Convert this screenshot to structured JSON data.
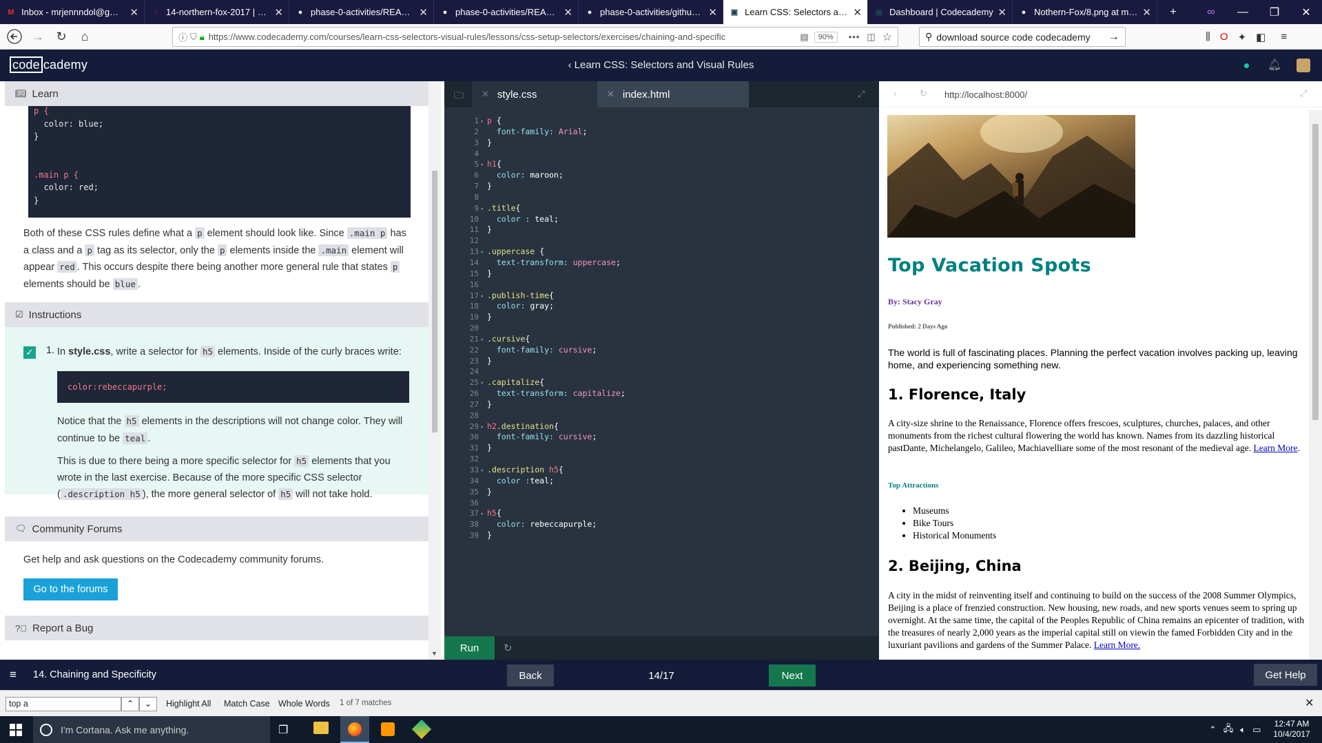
{
  "browser": {
    "tabs": [
      {
        "label": "Inbox - mrjennndol@gmail.c",
        "icon": "gmail-icon",
        "color": "#d93025",
        "glyph": "M"
      },
      {
        "label": "14-northern-fox-2017 | Hack",
        "icon": "slack-icon",
        "color": "#4a154b",
        "glyph": "#"
      },
      {
        "label": "phase-0-activities/README.",
        "icon": "github-icon",
        "color": "#ffffff",
        "glyph": "●"
      },
      {
        "label": "phase-0-activities/README.",
        "icon": "github-icon",
        "color": "#ffffff",
        "glyph": "●"
      },
      {
        "label": "phase-0-activities/github-p",
        "icon": "github-icon",
        "color": "#ffffff",
        "glyph": "●"
      },
      {
        "label": "Learn CSS: Selectors and Visu",
        "icon": "codecademy-icon",
        "color": "#1f4056",
        "glyph": "▣",
        "active": true
      },
      {
        "label": "Dashboard | Codecademy",
        "icon": "codecademy-icon",
        "color": "#1f4056",
        "glyph": "▣"
      },
      {
        "label": "Nothern-Fox/8.png at maste",
        "icon": "github-icon",
        "color": "#ffffff",
        "glyph": "●"
      }
    ],
    "url": "https://www.codecademy.com/courses/learn-css-selectors-visual-rules/lessons/css-setup-selectors/exercises/chaining-and-specific",
    "zoom": "90%",
    "search": "download source code codecademy",
    "menu_dots": "•••"
  },
  "codecademy": {
    "logo_code": "code",
    "logo_rest": "cademy",
    "course_title": "Learn CSS: Selectors and Visual Rules",
    "lesson_label": "14. Chaining and Specificity",
    "back": "Back",
    "progress": "14/17",
    "next": "Next",
    "get_help": "Get Help"
  },
  "learn": {
    "header": "Learn",
    "code_lines": [
      "p {",
      "  color: blue;",
      "}",
      "",
      "",
      ".main p {",
      "  color: red;",
      "}"
    ],
    "para": {
      "t1": "Both of these CSS rules define what a ",
      "c1": "p",
      "t2": " element should look like. Since ",
      "c2": ".main p",
      "t3": " has a class and a ",
      "c3": "p",
      "t4": " tag as its selector, only the ",
      "c4": "p",
      "t5": " elements inside the ",
      "c5": ".main",
      "t6": " element will appear ",
      "c6": "red",
      "t7": ". This occurs despite there being another more general rule that states ",
      "c7": "p",
      "t8": " elements should be ",
      "c8": "blue",
      "t9": "."
    }
  },
  "instructions": {
    "header": "Instructions",
    "step_num": "1.",
    "s1": "In ",
    "s_file": "style.css",
    "s2": ", write a selector for ",
    "s_code": "h5",
    "s3": " elements. Inside of the curly braces write:",
    "code_prop": "color:",
    "code_val": " rebeccapurple;",
    "n1": "Notice that the ",
    "n_code": "h5",
    "n2": " elements in the descriptions will not change color. They will continue to be ",
    "n_code2": "teal",
    "n3": ".",
    "m1": "This is due to there being a more specific selector for ",
    "m_code": "h5",
    "m2": " elements that you wrote in the last exercise. Because of the more specific CSS selector (",
    "m_code2": ".description h5",
    "m3": "), the more general selector of ",
    "m_code3": "h5",
    "m4": " will not take hold."
  },
  "community": {
    "header": "Community Forums",
    "text": "Get help and ask questions on the Codecademy community forums.",
    "button": "Go to the forums"
  },
  "report": {
    "header": "Report a Bug"
  },
  "editor": {
    "tab_css": "style.css",
    "tab_html": "index.html",
    "run": "Run",
    "lines": [
      {
        "n": "1",
        "f": "▾",
        "parts": [
          [
            "sel2",
            "p "
          ],
          [
            "w",
            "{"
          ]
        ]
      },
      {
        "n": "2",
        "parts": [
          [
            "pr",
            "  font-family: "
          ],
          [
            "vl",
            "Arial"
          ],
          [
            "w",
            ";"
          ]
        ]
      },
      {
        "n": "3",
        "parts": [
          [
            "w",
            "}"
          ]
        ]
      },
      {
        "n": "4",
        "parts": []
      },
      {
        "n": "5",
        "f": "▾",
        "parts": [
          [
            "sel2",
            "h1"
          ],
          [
            "w",
            "{"
          ]
        ]
      },
      {
        "n": "6",
        "parts": [
          [
            "pr",
            "  color: "
          ],
          [
            "vl2",
            "maroon"
          ],
          [
            "w",
            ";"
          ]
        ]
      },
      {
        "n": "7",
        "parts": [
          [
            "w",
            "}"
          ]
        ]
      },
      {
        "n": "8",
        "parts": []
      },
      {
        "n": "9",
        "f": "▾",
        "parts": [
          [
            "sel",
            ".title"
          ],
          [
            "w",
            "{"
          ]
        ]
      },
      {
        "n": "10",
        "parts": [
          [
            "pr",
            "  color : "
          ],
          [
            "vl2",
            "teal"
          ],
          [
            "w",
            ";"
          ]
        ]
      },
      {
        "n": "11",
        "parts": [
          [
            "w",
            "}"
          ]
        ]
      },
      {
        "n": "12",
        "parts": []
      },
      {
        "n": "13",
        "f": "▾",
        "parts": [
          [
            "sel",
            ".uppercase "
          ],
          [
            "w",
            "{"
          ]
        ]
      },
      {
        "n": "14",
        "parts": [
          [
            "pr",
            "  text-transform: "
          ],
          [
            "vl",
            "uppercase"
          ],
          [
            "w",
            ";"
          ]
        ]
      },
      {
        "n": "15",
        "parts": [
          [
            "w",
            "}"
          ]
        ]
      },
      {
        "n": "16",
        "parts": []
      },
      {
        "n": "17",
        "f": "▾",
        "parts": [
          [
            "sel",
            ".publish-time"
          ],
          [
            "w",
            "{"
          ]
        ]
      },
      {
        "n": "18",
        "parts": [
          [
            "pr",
            "  color: "
          ],
          [
            "vl2",
            "gray"
          ],
          [
            "w",
            ";"
          ]
        ]
      },
      {
        "n": "19",
        "parts": [
          [
            "w",
            "}"
          ]
        ]
      },
      {
        "n": "20",
        "parts": []
      },
      {
        "n": "21",
        "f": "▾",
        "parts": [
          [
            "sel",
            ".cursive"
          ],
          [
            "w",
            "{"
          ]
        ]
      },
      {
        "n": "22",
        "parts": [
          [
            "pr",
            "  font-family: "
          ],
          [
            "vl",
            "cursive"
          ],
          [
            "w",
            ";"
          ]
        ]
      },
      {
        "n": "23",
        "parts": [
          [
            "w",
            "}"
          ]
        ]
      },
      {
        "n": "24",
        "parts": []
      },
      {
        "n": "25",
        "f": "▾",
        "parts": [
          [
            "sel",
            ".capitalize"
          ],
          [
            "w",
            "{"
          ]
        ]
      },
      {
        "n": "26",
        "parts": [
          [
            "pr",
            "  text-transform: "
          ],
          [
            "vl",
            "capitalize"
          ],
          [
            "w",
            ";"
          ]
        ]
      },
      {
        "n": "27",
        "parts": [
          [
            "w",
            "}"
          ]
        ]
      },
      {
        "n": "28",
        "parts": []
      },
      {
        "n": "29",
        "f": "▾",
        "parts": [
          [
            "sel2",
            "h2"
          ],
          [
            "sel",
            ".destination"
          ],
          [
            "w",
            "{"
          ]
        ]
      },
      {
        "n": "30",
        "parts": [
          [
            "pr",
            "  font-family: "
          ],
          [
            "vl",
            "cursive"
          ],
          [
            "w",
            ";"
          ]
        ]
      },
      {
        "n": "31",
        "parts": [
          [
            "w",
            "}"
          ]
        ]
      },
      {
        "n": "32",
        "parts": []
      },
      {
        "n": "33",
        "f": "▾",
        "parts": [
          [
            "sel",
            ".description "
          ],
          [
            "sel2",
            "h5"
          ],
          [
            "w",
            "{"
          ]
        ]
      },
      {
        "n": "34",
        "parts": [
          [
            "pr",
            "  color :"
          ],
          [
            "vl2",
            "teal"
          ],
          [
            "w",
            ";"
          ]
        ]
      },
      {
        "n": "35",
        "parts": [
          [
            "w",
            "}"
          ]
        ]
      },
      {
        "n": "36",
        "parts": []
      },
      {
        "n": "37",
        "f": "▾",
        "parts": [
          [
            "sel2",
            "h5"
          ],
          [
            "w",
            "{"
          ]
        ]
      },
      {
        "n": "38",
        "parts": [
          [
            "pr",
            "  color: "
          ],
          [
            "vl2",
            "rebeccapurple"
          ],
          [
            "w",
            ";"
          ]
        ]
      },
      {
        "n": "39",
        "parts": [
          [
            "w",
            "}"
          ]
        ]
      }
    ]
  },
  "preview": {
    "url": "http://localhost:8000/",
    "title": "Top Vacation Spots",
    "byline": "By: Stacy Gray",
    "published": "Published: 2 Days Ago",
    "intro": "The world is full of fascinating places. Planning the perfect vacation involves packing up, leaving home, and experiencing something new.",
    "dest1": "1. Florence, Italy",
    "dest1_text": "A city-size shrine to the Renaissance, Florence offers frescoes, sculptures, churches, palaces, and other monuments from the richest cultural flowering the world has known. Names from its dazzling historical pastDante, Michelangelo, Galileo, Machiavelliare some of the most resonant of the medieval age.",
    "learn_more": "Learn More",
    "top_attr": "Top Attractions",
    "attractions": [
      "Museums",
      "Bike Tours",
      "Historical Monuments"
    ],
    "dest2": "2. Beijing, China",
    "dest2_text": "A city in the midst of reinventing itself and continuing to build on the success of the 2008 Summer Olympics, Beijing is a place of frenzied construction. New housing, new roads, and new sports venues seem to spring up overnight. At the same time, the capital of the Peoples Republic of China remains an epicenter of tradition, with the treasures of nearly 2,000 years as the imperial capital still on viewin the famed Forbidden City and in the luxuriant pavilions and gardens of the Summer Palace.",
    "learn_more2": "Learn More."
  },
  "findbar": {
    "query": "top a",
    "highlight": "Highlight All",
    "match_case": "Match Case",
    "whole_words": "Whole Words",
    "matches": "1 of 7 matches"
  },
  "taskbar": {
    "cortana": "I'm Cortana. Ask me anything.",
    "time": "12:47 AM",
    "date": "10/4/2017"
  },
  "colors": {
    "teal": "#008080",
    "rebeccapurple": "#663399",
    "run_green": "#15774d",
    "header_navy": "#141c3a"
  }
}
